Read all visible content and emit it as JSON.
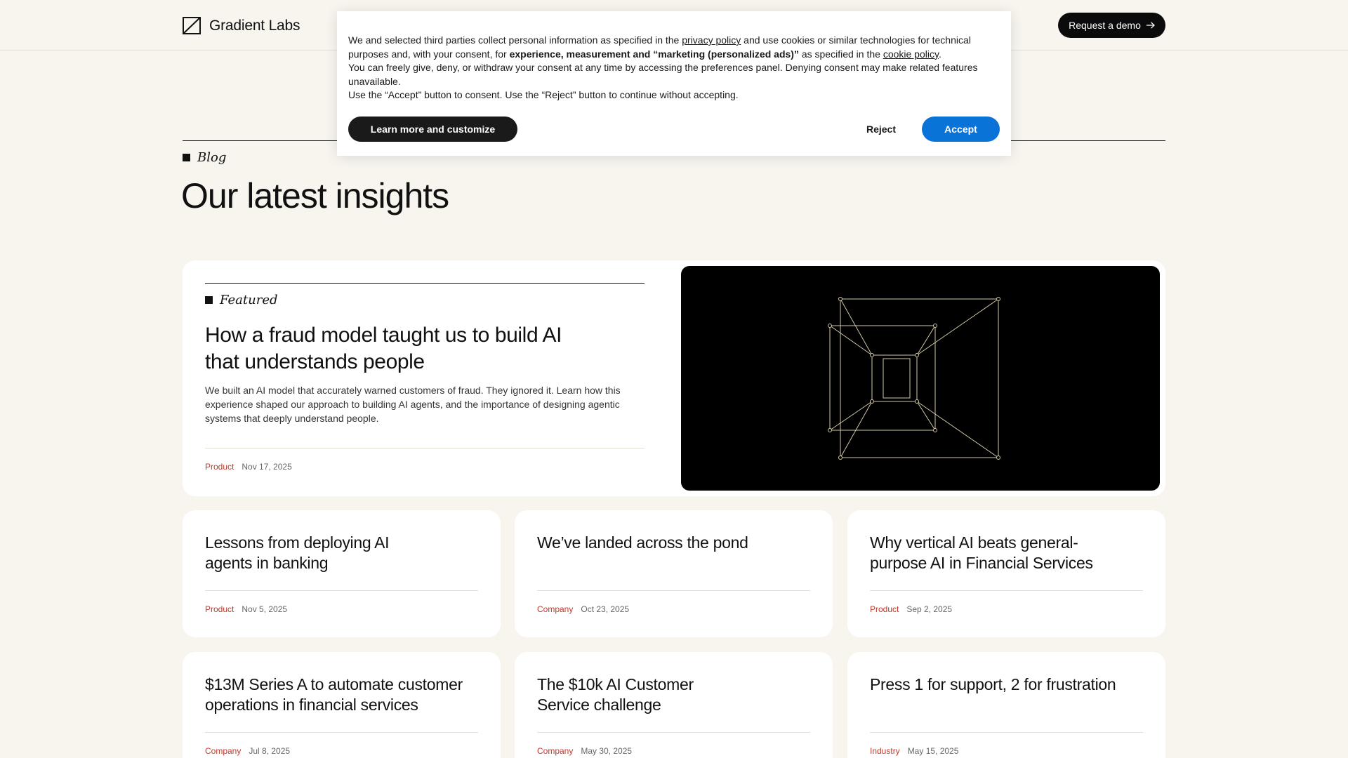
{
  "header": {
    "logo_text": "Gradient Labs",
    "demo_button": "Request a demo"
  },
  "blog": {
    "label": "Blog",
    "title": "Our latest insights"
  },
  "featured": {
    "label": "Featured",
    "title": "How a fraud model taught us to build AI that understands people",
    "description": "We built an AI model that accurately warned customers of fraud. They ignored it. Learn how this experience shaped our approach to building AI agents, and the importance of designing agentic systems that deeply understand people.",
    "category": "Product",
    "date": "Nov 17, 2025"
  },
  "posts": [
    {
      "title": "Lessons from deploying AI agents in banking",
      "category": "Product",
      "date": "Nov 5, 2025"
    },
    {
      "title": "We’ve landed across the pond",
      "category": "Company",
      "date": "Oct 23, 2025"
    },
    {
      "title": "Why vertical AI beats general-purpose AI in Financial Services",
      "category": "Product",
      "date": "Sep 2, 2025"
    },
    {
      "title": "$13M Series A to automate customer operations in financial services",
      "category": "Company",
      "date": "Jul 8, 2025"
    },
    {
      "title": "The $10k AI Customer Service challenge",
      "category": "Company",
      "date": "May 30, 2025"
    },
    {
      "title": "Press 1 for support, 2 for frustration",
      "category": "Industry",
      "date": "May 15, 2025"
    }
  ],
  "cookie": {
    "text_1a": "We and selected third parties collect personal information as specified in the ",
    "privacy_link": "privacy policy",
    "text_1b": " and use cookies or similar technologies for technical purposes and, with your consent, for ",
    "text_bold": "experience, measurement and “marketing (personalized ads)”",
    "text_1c": " as specified in the ",
    "cookie_link": "cookie policy",
    "text_1d": ".",
    "text_2": "You can freely give, deny, or withdraw your consent at any time by accessing the preferences panel. Denying consent may make related features unavailable.",
    "text_3": "Use the “Accept” button to consent. Use the “Reject” button to continue without accepting.",
    "customize_button": "Learn more and customize",
    "reject_button": "Reject",
    "accept_button": "Accept"
  },
  "colors": {
    "background": "#f8f5ef",
    "category_red": "#c0392b",
    "accept_blue": "#0a73d8",
    "featured_line": "#d4c9a8"
  },
  "icons": {
    "logo": "gradient-labs-logo-icon",
    "demo_arrow": "arrow-right-icon"
  }
}
